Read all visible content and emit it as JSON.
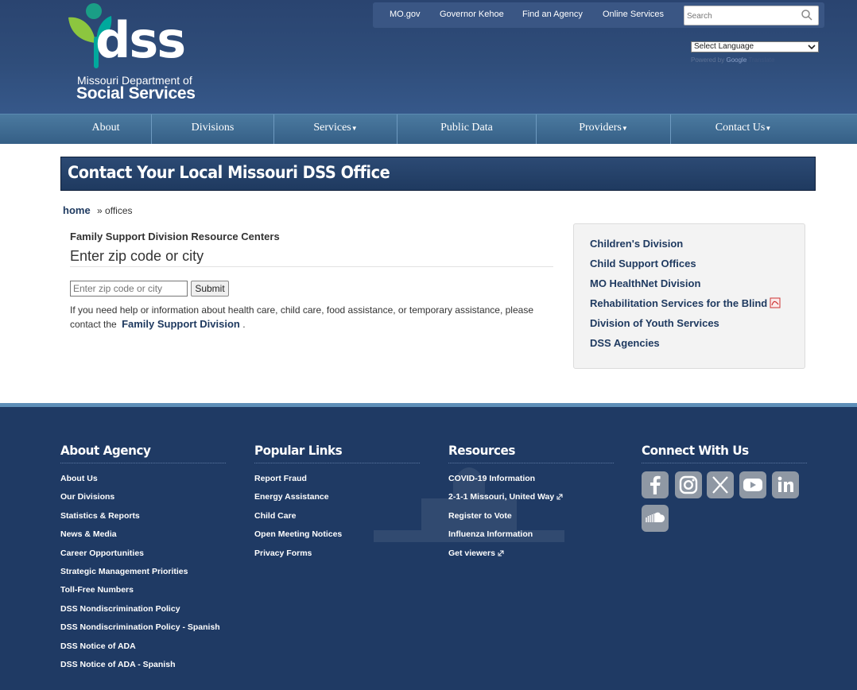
{
  "logo": {
    "brand": "dss",
    "line1": "Missouri Department of",
    "line2": "Social Services"
  },
  "utility": {
    "links": [
      "MO.gov",
      "Governor Kehoe",
      "Find an Agency",
      "Online Services"
    ],
    "search_placeholder": "Search"
  },
  "language": {
    "selected": "Select Language",
    "powered_by": "Powered by",
    "google": "Google",
    "translate": "Translate"
  },
  "nav": {
    "items": [
      {
        "label": "About",
        "dropdown": false
      },
      {
        "label": "Divisions",
        "dropdown": false
      },
      {
        "label": "Services",
        "dropdown": true
      },
      {
        "label": "Public Data",
        "dropdown": false
      },
      {
        "label": "Providers",
        "dropdown": true
      },
      {
        "label": "Contact Us",
        "dropdown": true
      }
    ]
  },
  "page": {
    "title": "Contact Your Local Missouri DSS Office",
    "breadcrumb_home": "home",
    "breadcrumb_sep": "»",
    "breadcrumb_current": "offices"
  },
  "main": {
    "section_label": "Family Support Division Resource Centers",
    "big_label": "Enter zip code or city",
    "zip_placeholder": "Enter zip code or city",
    "submit_label": "Submit",
    "help_text": "If you need help or information about health care, child care, food assistance, or temporary assistance, please contact the",
    "help_link": "Family Support Division",
    "help_end": "."
  },
  "sidebar": {
    "links": [
      "Children's Division",
      "Child Support Offices",
      "MO HealthNet Division",
      "Rehabilitation Services for the Blind",
      "Division of Youth Services",
      "DSS Agencies"
    ]
  },
  "footer": {
    "about": {
      "heading": "About Agency",
      "links": [
        "About Us",
        "Our Divisions",
        "Statistics & Reports",
        "News & Media",
        "Career Opportunities",
        "Strategic Management Priorities",
        "Toll-Free Numbers",
        "DSS Nondiscrimination Policy",
        "DSS Nondiscrimination Policy - Spanish",
        "DSS Notice of ADA",
        "DSS Notice of ADA - Spanish"
      ]
    },
    "popular": {
      "heading": "Popular Links",
      "links": [
        "Report Fraud",
        "Energy Assistance",
        "Child Care",
        "Open Meeting Notices",
        "Privacy Forms"
      ]
    },
    "resources": {
      "heading": "Resources",
      "links": [
        "COVID-19 Information",
        "2-1-1 Missouri, United Way",
        "Register to Vote",
        "Influenza Information",
        "Get viewers"
      ]
    },
    "connect": {
      "heading": "Connect With Us",
      "icons": [
        "facebook-icon",
        "instagram-icon",
        "x-twitter-icon",
        "youtube-icon",
        "linkedin-icon",
        "soundcloud-icon"
      ]
    }
  },
  "colors": {
    "header_bg": "#2f4d7a",
    "nav_bg": "#4b7aa0",
    "title_bg": "#2c4a74",
    "link": "#1f3a60",
    "footer_bg": "#1f3a64",
    "footer_accent": "#5e8fb8",
    "logo_green": "#8cc63f",
    "logo_teal": "#00a99d"
  }
}
